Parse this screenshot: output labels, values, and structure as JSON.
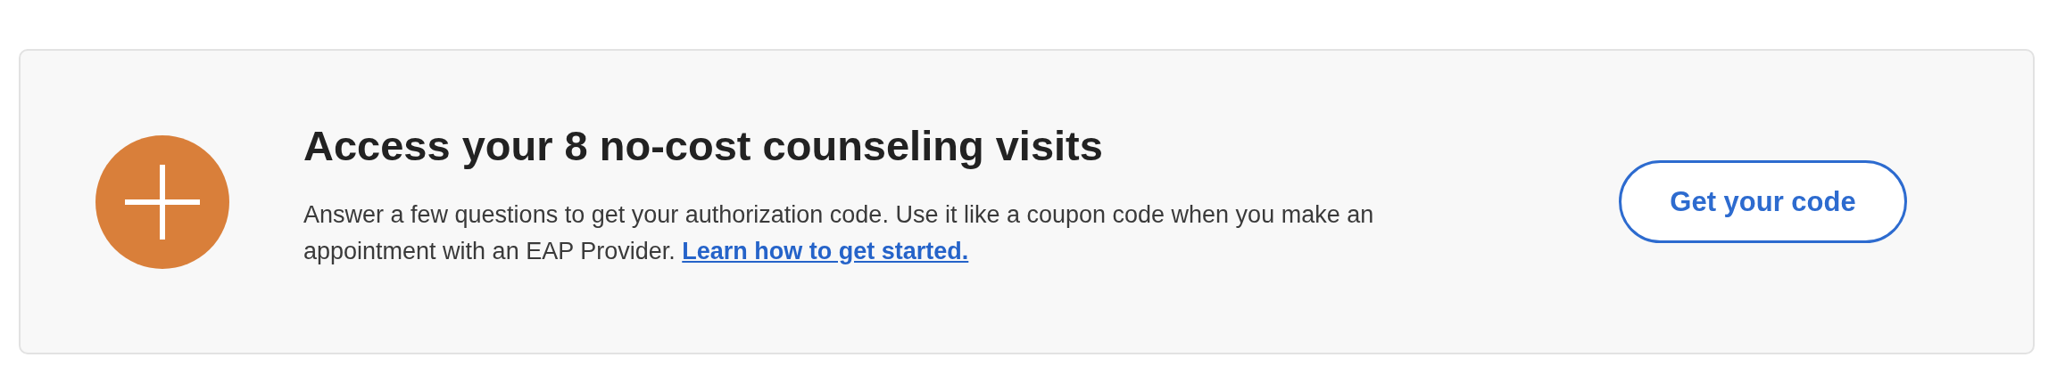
{
  "card": {
    "title": "Access your 8 no-cost counseling visits",
    "description": "Answer a few questions to get your authorization code. Use it like a coupon code when you make an appointment with an EAP Provider.",
    "link": "Learn how to get started.",
    "button": "Get your code"
  }
}
